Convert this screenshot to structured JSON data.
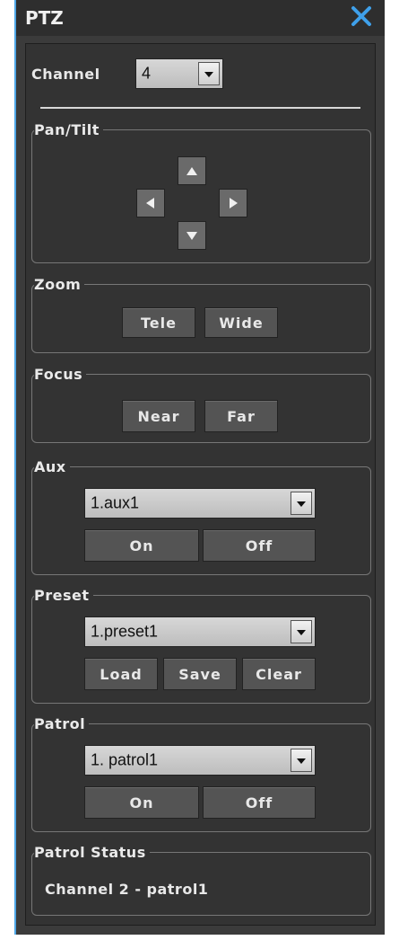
{
  "window": {
    "title": "PTZ",
    "accent": "#4fa6e6"
  },
  "channel": {
    "label": "Channel",
    "value": "4"
  },
  "pan_tilt": {
    "legend": "Pan/Tilt"
  },
  "zoom": {
    "legend": "Zoom",
    "tele": "Tele",
    "wide": "Wide"
  },
  "focus": {
    "legend": "Focus",
    "near": "Near",
    "far": "Far"
  },
  "aux": {
    "legend": "Aux",
    "selected": "1.aux1",
    "on": "On",
    "off": "Off"
  },
  "preset": {
    "legend": "Preset",
    "selected": "1.preset1",
    "load": "Load",
    "save": "Save",
    "clear": "Clear"
  },
  "patrol": {
    "legend": "Patrol",
    "selected": "1. patrol1",
    "on": "On",
    "off": "Off"
  },
  "patrol_status": {
    "legend": "Patrol Status",
    "text": "Channel 2 - patrol1"
  },
  "icons": [
    "close-icon",
    "arrow-up-icon",
    "arrow-left-icon",
    "arrow-right-icon",
    "arrow-down-icon",
    "dropdown-arrow-icon"
  ]
}
